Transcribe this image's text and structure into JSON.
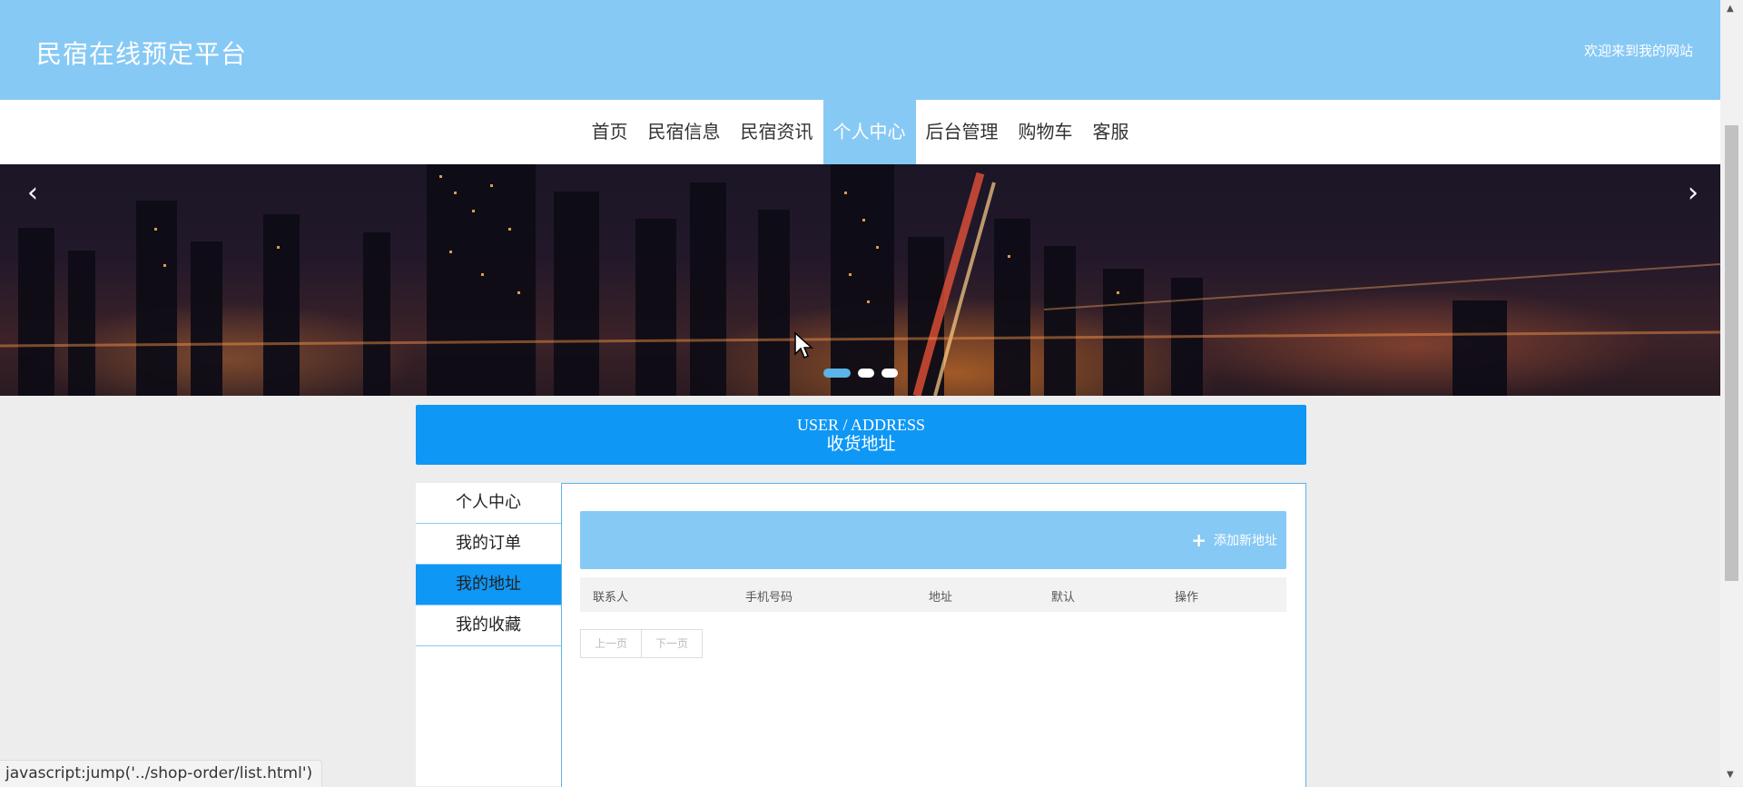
{
  "header": {
    "title": "民宿在线预定平台",
    "welcome": "欢迎来到我的网站"
  },
  "nav": {
    "items": [
      {
        "label": "首页"
      },
      {
        "label": "民宿信息"
      },
      {
        "label": "民宿资讯"
      },
      {
        "label": "个人中心",
        "active": true
      },
      {
        "label": "后台管理"
      },
      {
        "label": "购物车"
      },
      {
        "label": "客服"
      }
    ]
  },
  "banner": {
    "prev_icon": "‹",
    "next_icon": "›",
    "slide_count": 3,
    "active_slide": 1
  },
  "section": {
    "title_en": "USER / ADDRESS",
    "title_cn": "收货地址"
  },
  "sidebar": {
    "items": [
      {
        "label": "个人中心"
      },
      {
        "label": "我的订单"
      },
      {
        "label": "我的地址",
        "active": true
      },
      {
        "label": "我的收藏"
      }
    ]
  },
  "toolbar": {
    "add_label": "添加新地址",
    "add_icon": "+"
  },
  "table": {
    "columns": [
      "联系人",
      "手机号码",
      "地址",
      "默认",
      "操作"
    ]
  },
  "pager": {
    "prev": "上一页",
    "next": "下一页"
  },
  "status_bar": {
    "text": "javascript:jump('../shop-order/list.html')"
  },
  "colors": {
    "header": "#87c9f5",
    "accent": "#0f97f5",
    "border": "#5bb4e8",
    "page_bg": "#ededed"
  }
}
